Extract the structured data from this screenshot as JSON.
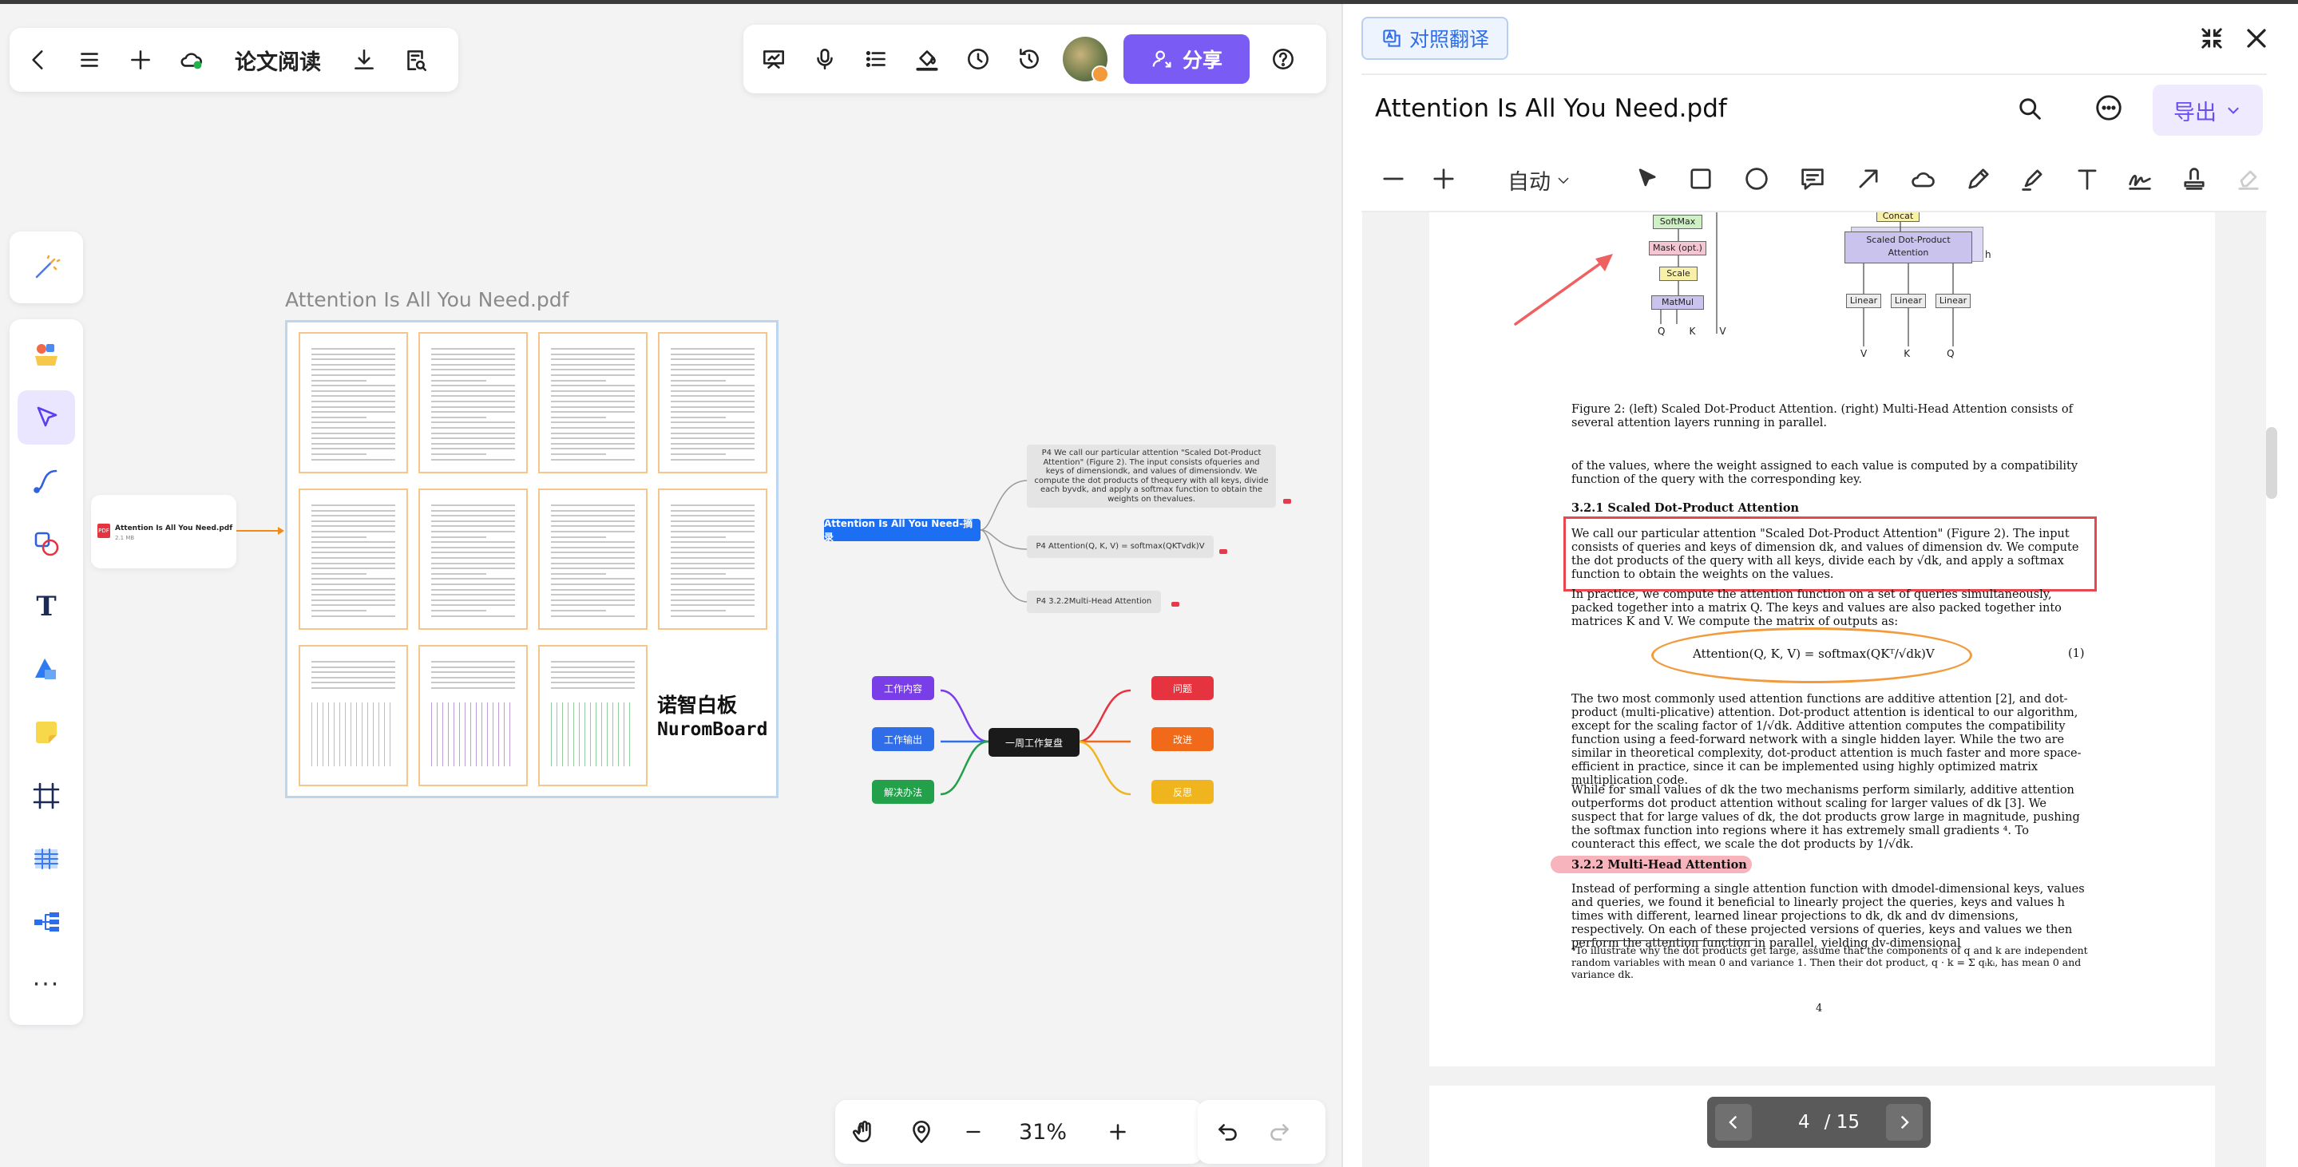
{
  "toolbar_left": {
    "title": "论文阅读",
    "icons": [
      "back-icon",
      "menu-icon",
      "plus-icon",
      "cloud-sync-icon",
      "download-icon",
      "search-doc-icon"
    ]
  },
  "toolbar_right": {
    "share_label": "分享",
    "icons": [
      "presentation-icon",
      "microphone-icon",
      "list-icon",
      "fill-icon",
      "clock-icon",
      "history-icon",
      "help-icon"
    ]
  },
  "left_tools": [
    "magic-pen-icon",
    "templates-icon",
    "select-cursor-icon",
    "connector-icon",
    "shapes-icon",
    "text-icon",
    "shape-icon",
    "sticky-note-icon",
    "frame-icon",
    "table-icon",
    "mindmap-icon",
    "more-icon"
  ],
  "board": {
    "doc_title": "Attention Is All You Need.pdf",
    "brand_cn": "诺智白板",
    "brand_en": "NuromBoard",
    "file_card": {
      "name": "Attention Is All You Need.pdf",
      "size": "2.1 MB"
    },
    "mindmap": {
      "root": "Attention Is All You Need-摘录",
      "nodes": [
        "P4 We call our particular attention \"Scaled Dot-Product Attention\" (Figure 2). The input consists ofqueries and keys of dimensiondk, and values of dimensiondv. We compute the dot products of thequery with all keys, divide each byvdk, and apply a softmax function to obtain the weights on thevalues.",
        "P4 Attention(Q, K, V) = softmax(QKTvdk)V",
        "P4 3.2.2Multi-Head Attention"
      ]
    },
    "weekly": {
      "center": "一周工作复盘",
      "left": [
        {
          "label": "工作内容",
          "color": "#7a3ee8"
        },
        {
          "label": "工作输出",
          "color": "#2f6ee8"
        },
        {
          "label": "解决办法",
          "color": "#22a04a"
        }
      ],
      "right": [
        {
          "label": "问题",
          "color": "#e5343f"
        },
        {
          "label": "改进",
          "color": "#f06a1a"
        },
        {
          "label": "反思",
          "color": "#f0b51e"
        }
      ]
    }
  },
  "zoom": {
    "value": "31%"
  },
  "panel": {
    "translate_label": "对照翻译",
    "title": "Attention Is All You Need.pdf",
    "export_label": "导出",
    "zoom_mode": "自动",
    "page_current": "4",
    "page_total": "/ 15"
  },
  "pdf": {
    "fig_labels_left": [
      "SoftMax",
      "Mask (opt.)",
      "Scale",
      "MatMul"
    ],
    "fig_qkv_left": [
      "Q",
      "K",
      "V"
    ],
    "fig_labels_right": [
      "Concat",
      "Scaled Dot-Product Attention",
      "Linear",
      "Linear",
      "Linear"
    ],
    "fig_qkv_right": [
      "V",
      "K",
      "Q"
    ],
    "fig_h": "h",
    "caption": "Figure 2: (left) Scaled Dot-Product Attention. (right) Multi-Head Attention consists of several attention layers running in parallel.",
    "p1": "of the values, where the weight assigned to each value is computed by a compatibility function of the query with the corresponding key.",
    "h321": "3.2.1   Scaled Dot-Product Attention",
    "p2": "We call our particular attention \"Scaled Dot-Product Attention\" (Figure 2). The input consists of queries and keys of dimension dk, and values of dimension dv. We compute the dot products of the query with all keys, divide each by √dk, and apply a softmax function to obtain the weights on the values.",
    "p3": "In practice, we compute the attention function on a set of queries simultaneously, packed together into a matrix Q. The keys and values are also packed together into matrices K and V. We compute the matrix of outputs as:",
    "eq": "Attention(Q, K, V) = softmax(QKᵀ/√dk)V",
    "eqnum": "(1)",
    "p4": "The two most commonly used attention functions are additive attention [2], and dot-product (multi-plicative) attention. Dot-product attention is identical to our algorithm, except for the scaling factor of 1/√dk. Additive attention computes the compatibility function using a feed-forward network with a single hidden layer. While the two are similar in theoretical complexity, dot-product attention is much faster and more space-efficient in practice, since it can be implemented using highly optimized matrix multiplication code.",
    "p5": "While for small values of dk the two mechanisms perform similarly, additive attention outperforms dot product attention without scaling for larger values of dk [3]. We suspect that for large values of dk, the dot products grow large in magnitude, pushing the softmax function into regions where it has extremely small gradients ⁴. To counteract this effect, we scale the dot products by 1/√dk.",
    "h322": "3.2.2   Multi-Head Attention",
    "p6": "Instead of performing a single attention function with dmodel-dimensional keys, values and queries, we found it beneficial to linearly project the queries, keys and values h times with different, learned linear projections to dk, dk and dv dimensions, respectively. On each of these projected versions of queries, keys and values we then perform the attention function in parallel, yielding dv-dimensional",
    "footnote": "⁴To illustrate why the dot products get large, assume that the components of q and k are independent random variables with mean 0 and variance 1. Then their dot product, q · k = Σ qᵢkᵢ, has mean 0 and variance dk.",
    "pagenum": "4"
  }
}
